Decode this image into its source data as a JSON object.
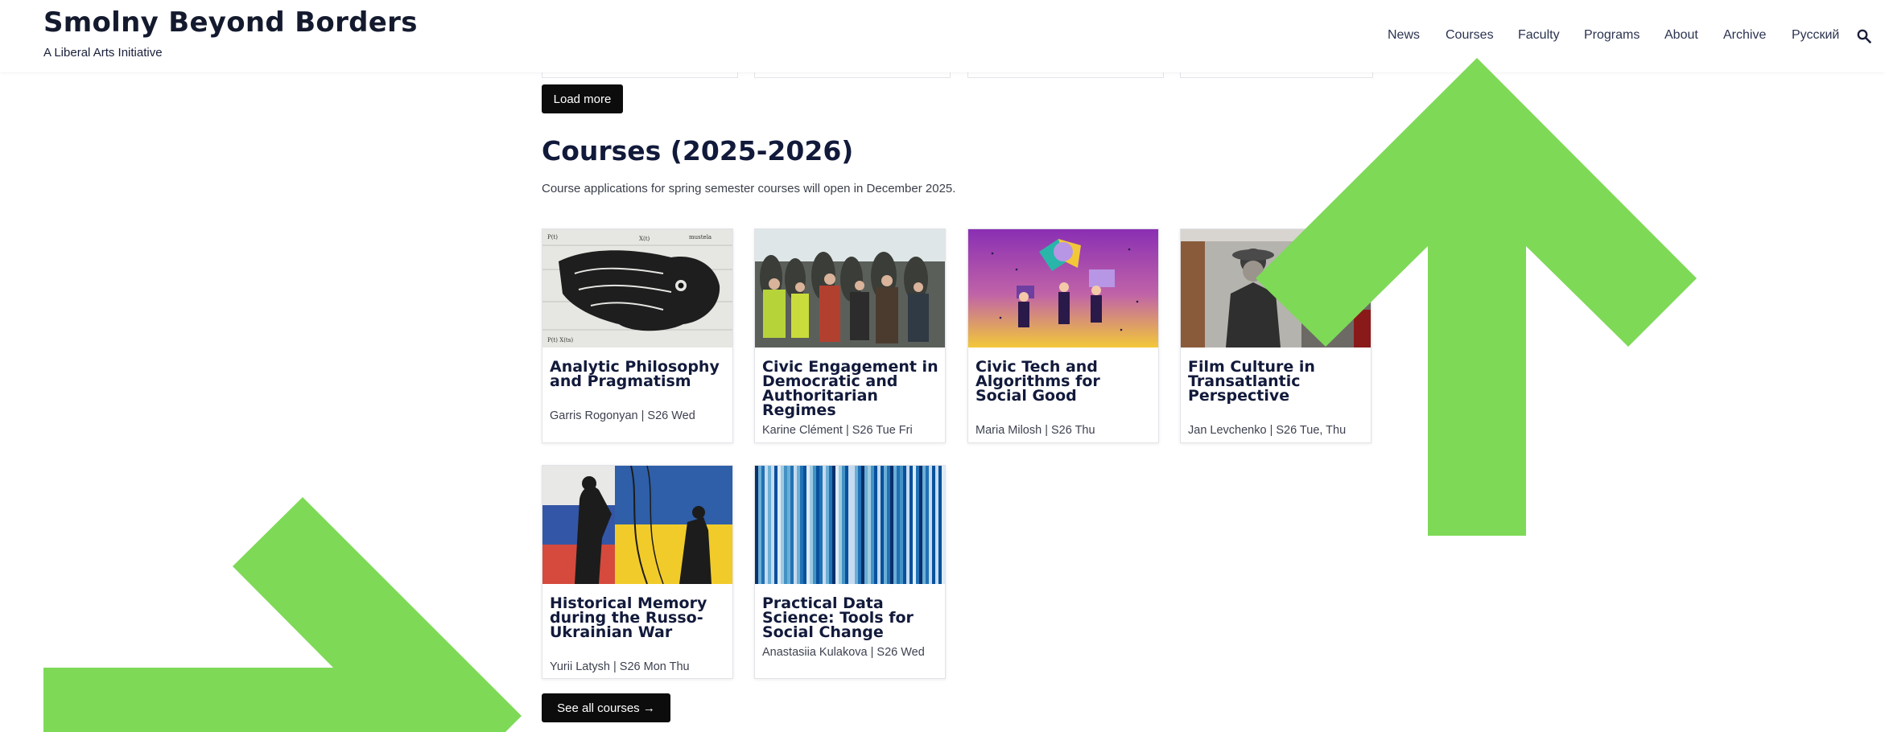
{
  "header": {
    "site_title": "Smolny Beyond Borders",
    "tagline": "A Liberal Arts Initiative",
    "nav": [
      "News",
      "Courses",
      "Faculty",
      "Programs",
      "About",
      "Archive",
      "Русский"
    ]
  },
  "load_more_label": "Load more",
  "section": {
    "title": "Courses (2025-2026)",
    "description": "Course applications for spring semester courses will open in December 2025."
  },
  "courses": [
    {
      "title": "Analytic Philosophy and Pragmatism",
      "meta": "Garris Rogonyan | S26 Wed"
    },
    {
      "title": "Civic Engagement in Democratic and Authoritarian Regimes",
      "meta": "Karine Clément | S26 Tue Fri"
    },
    {
      "title": "Civic Tech and Algorithms for Social Good",
      "meta": "Maria Milosh | S26 Thu"
    },
    {
      "title": "Film Culture in Transatlantic Perspective",
      "meta": "Jan Levchenko | S26 Tue, Thu"
    },
    {
      "title": "Historical Memory during the Russo-Ukrainian War",
      "meta": "Yurii Latysh | S26 Mon Thu"
    },
    {
      "title": "Practical Data Science: Tools for Social Change",
      "meta": "Anastasiia Kulakova | S26 Wed"
    }
  ],
  "see_all_label": "See all courses →",
  "colors": {
    "accent_arrow": "#7ed957",
    "button_bg": "#0c0c0c",
    "title_navy": "#121a3b"
  }
}
